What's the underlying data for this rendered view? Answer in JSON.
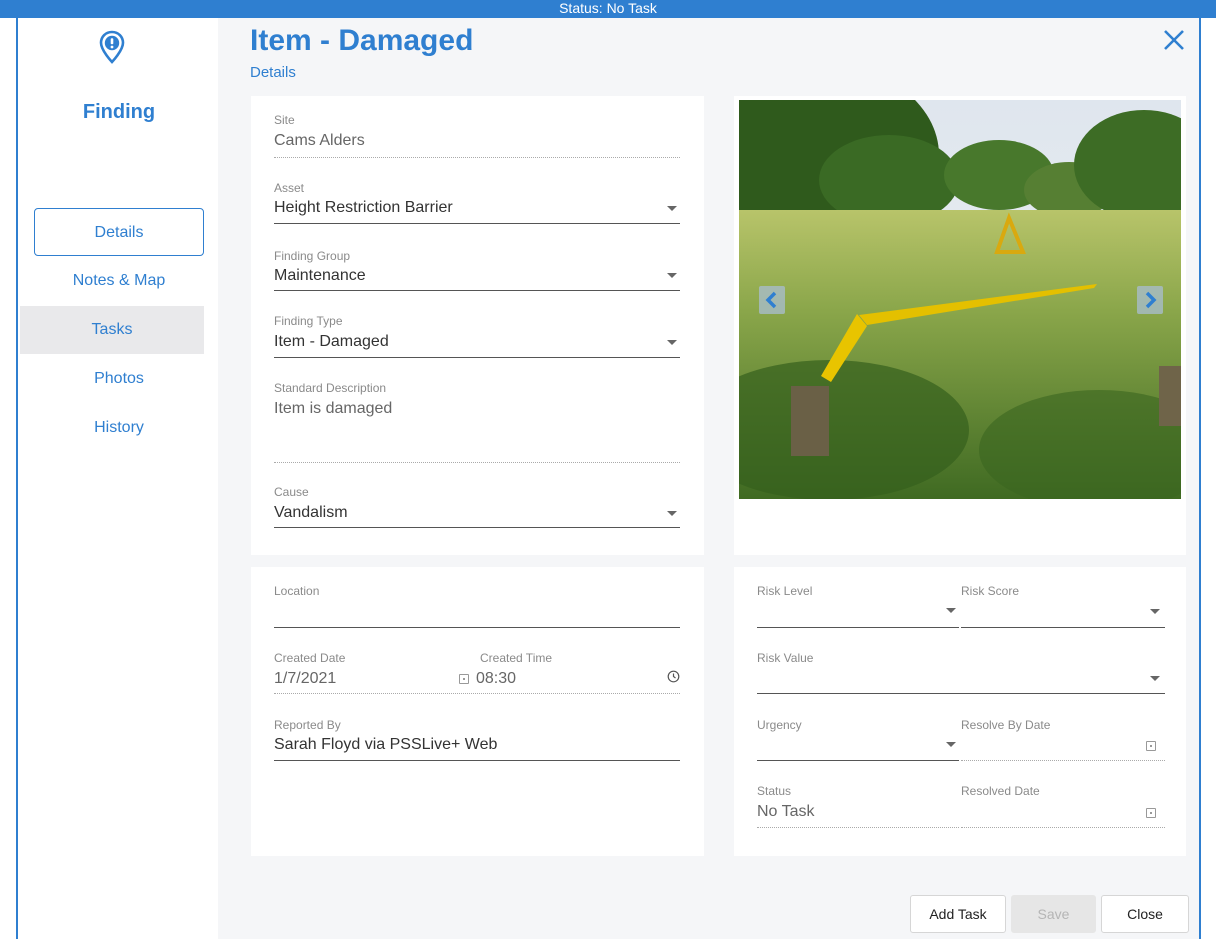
{
  "status_bar": {
    "text": "Status: No Task"
  },
  "sidebar": {
    "title": "Finding",
    "items": [
      {
        "label": "Details"
      },
      {
        "label": "Notes & Map"
      },
      {
        "label": "Tasks"
      },
      {
        "label": "Photos"
      },
      {
        "label": "History"
      }
    ]
  },
  "header": {
    "title": "Item - Damaged",
    "subtitle": "Details"
  },
  "details": {
    "site": {
      "label": "Site",
      "value": "Cams Alders"
    },
    "asset": {
      "label": "Asset",
      "value": "Height Restriction Barrier"
    },
    "finding_group": {
      "label": "Finding Group",
      "value": "Maintenance"
    },
    "finding_type": {
      "label": "Finding Type",
      "value": "Item - Damaged"
    },
    "standard_description": {
      "label": "Standard Description",
      "value": "Item is damaged"
    },
    "cause": {
      "label": "Cause",
      "value": "Vandalism"
    }
  },
  "location_card": {
    "location": {
      "label": "Location",
      "value": ""
    },
    "created_date": {
      "label": "Created Date",
      "value": "1/7/2021"
    },
    "created_time": {
      "label": "Created Time",
      "value": "08:30"
    },
    "reported_by": {
      "label": "Reported By",
      "value": "Sarah Floyd via PSSLive+ Web"
    }
  },
  "risk_card": {
    "risk_level": {
      "label": "Risk Level"
    },
    "risk_score": {
      "label": "Risk Score"
    },
    "risk_value": {
      "label": "Risk Value"
    },
    "urgency": {
      "label": "Urgency"
    },
    "resolve_by_date": {
      "label": "Resolve By Date"
    },
    "status": {
      "label": "Status",
      "value": "No Task"
    },
    "resolved_date": {
      "label": "Resolved Date"
    }
  },
  "footer": {
    "add_task_label": "Add Task",
    "save_label": "Save",
    "close_label": "Close"
  },
  "colors": {
    "accent": "#2f7fd0",
    "background": "#f5f6f8"
  }
}
